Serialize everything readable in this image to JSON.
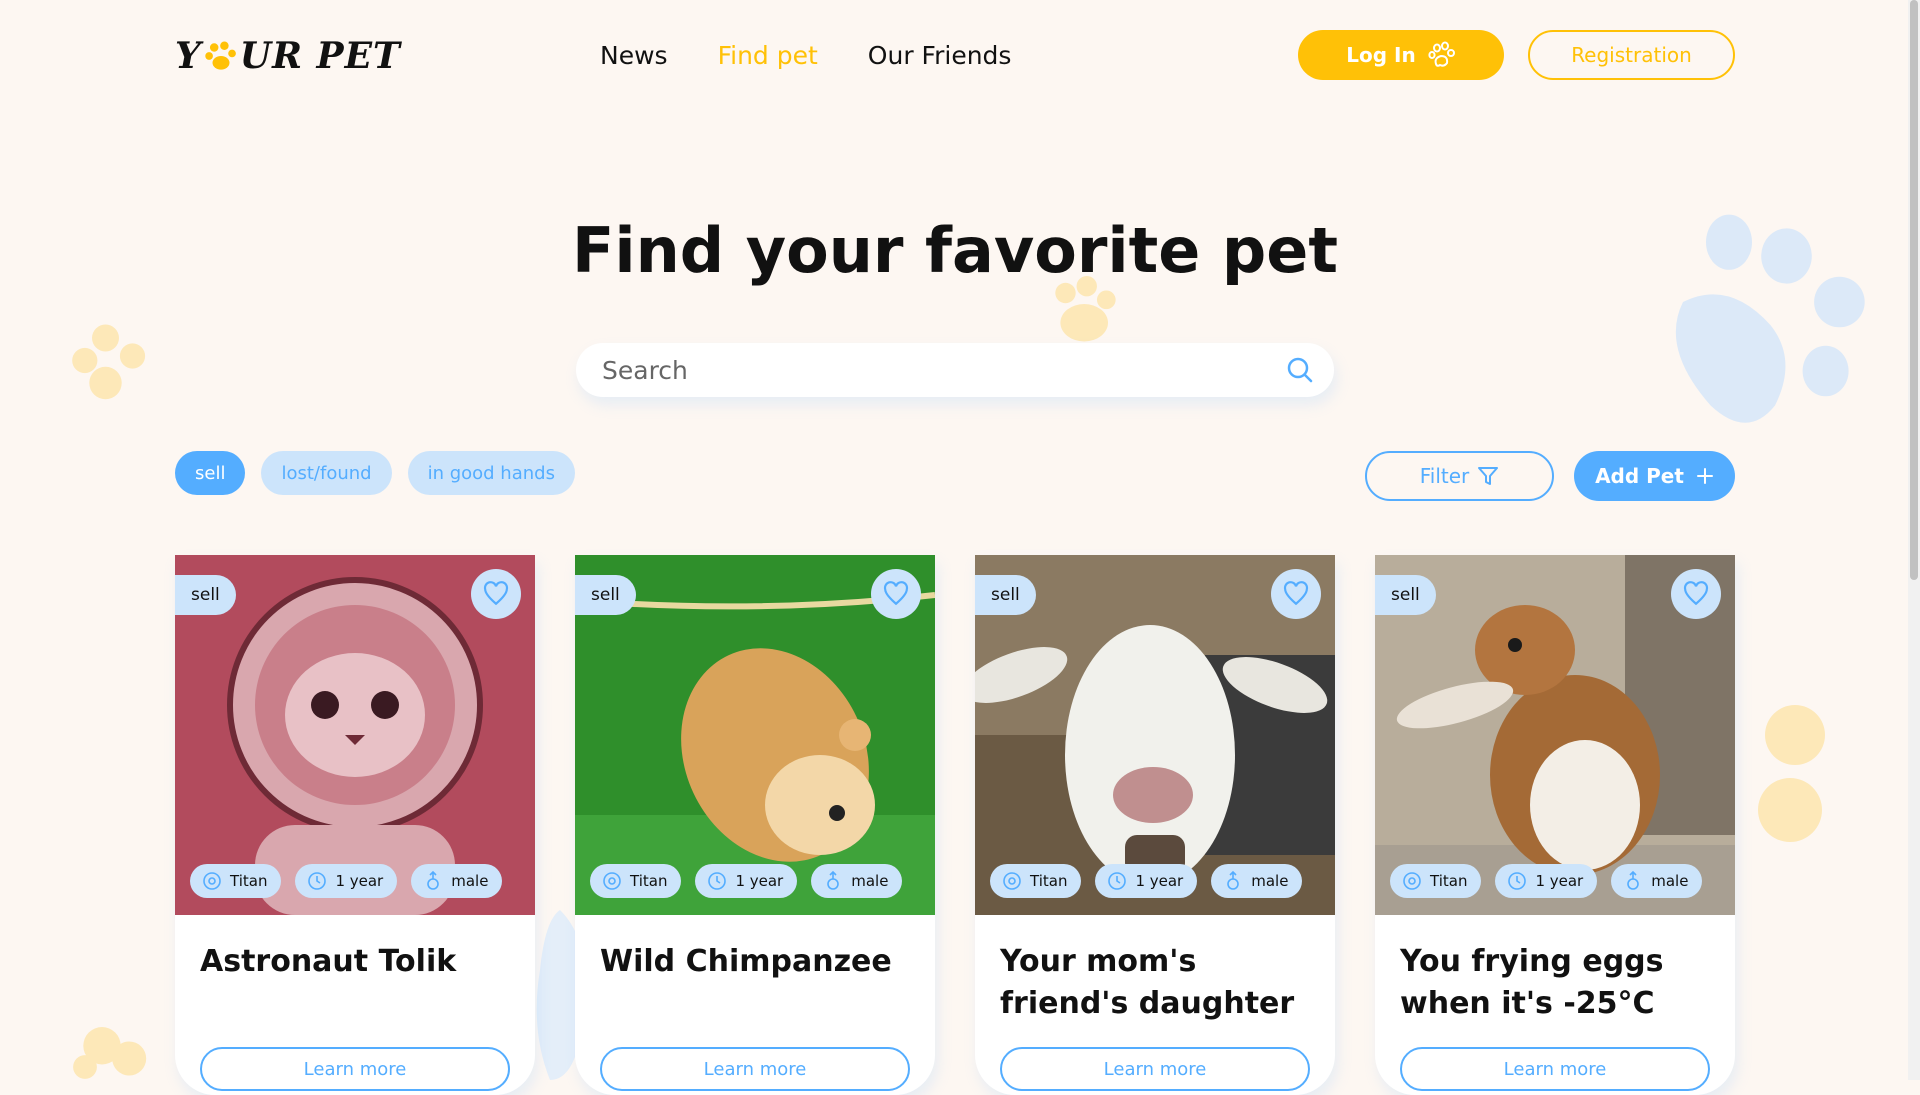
{
  "header": {
    "logo_text_left": "Y",
    "logo_text_right": "UR PET",
    "nav": [
      {
        "label": "News"
      },
      {
        "label": "Find pet"
      },
      {
        "label": "Our Friends"
      }
    ],
    "login_label": "Log In",
    "registration_label": "Registration"
  },
  "main": {
    "title": "Find your favorite pet",
    "search": {
      "placeholder": "Search",
      "value": ""
    },
    "categories": [
      {
        "label": "sell",
        "active": true
      },
      {
        "label": "lost/found",
        "active": false
      },
      {
        "label": "in good hands",
        "active": false
      }
    ],
    "filter_label": "Filter",
    "add_pet_label": "Add Pet"
  },
  "cards": [
    {
      "category": "sell",
      "title": "Astronaut Tolik",
      "location": "Titan",
      "age": "1 year",
      "sex": "male",
      "cta": "Learn more"
    },
    {
      "category": "sell",
      "title": "Wild Chimpanzee",
      "location": "Titan",
      "age": "1 year",
      "sex": "male",
      "cta": "Learn more"
    },
    {
      "category": "sell",
      "title": "Your mom's friend's daughter",
      "location": "Titan",
      "age": "1 year",
      "sex": "male",
      "cta": "Learn more"
    },
    {
      "category": "sell",
      "title": "You frying eggs when it's -25°C",
      "location": "Titan",
      "age": "1 year",
      "sex": "male",
      "cta": "Learn more"
    }
  ],
  "colors": {
    "accent_yellow": "#ffc107",
    "accent_blue": "#54adff",
    "light_blue": "#cce4fb",
    "background": "#fdf7f2"
  },
  "icons": {
    "login": "paw-icon",
    "search": "search-icon",
    "filter": "filter-icon",
    "add": "plus-icon",
    "favorite": "heart-icon",
    "location": "location-icon",
    "age": "clock-icon",
    "sex": "male-icon"
  }
}
